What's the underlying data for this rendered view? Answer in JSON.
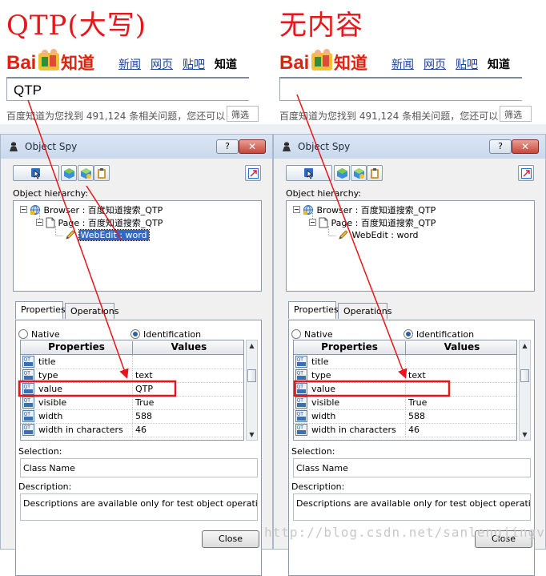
{
  "panels": [
    {
      "annotation": "QTP(大写)",
      "baidu": {
        "logo_text": "Bai知道",
        "nav_links": [
          "新闻",
          "网页",
          "贴吧"
        ],
        "nav_current": "知道",
        "search_value": "QTP",
        "found_text": "百度知道为您找到 491,124 条相关问题，您还可以",
        "filter_label": "筛选"
      },
      "window": {
        "title": "Object Spy",
        "help_label": "?",
        "close_label": "✕",
        "hierarchy_label": "Object hierarchy:",
        "tree": [
          "Browser : 百度知道搜索_QTP",
          "Page : 百度知道搜索_QTP",
          "WebEdit : word"
        ],
        "tabs": [
          "Properties",
          "Operations"
        ],
        "radios": [
          "Native",
          "Identification"
        ],
        "grid_headers": [
          "Properties",
          "Values"
        ],
        "rows": [
          {
            "name": "title",
            "value": ""
          },
          {
            "name": "type",
            "value": "text"
          },
          {
            "name": "value",
            "value": "QTP"
          },
          {
            "name": "visible",
            "value": "True"
          },
          {
            "name": "width",
            "value": "588"
          },
          {
            "name": "width in characters",
            "value": "46"
          }
        ],
        "selection_label": "Selection:",
        "selection_value": "Class Name",
        "description_label": "Description:",
        "description_value": "Descriptions are available only for test object operations.",
        "close_button": "Close"
      }
    },
    {
      "annotation": "无内容",
      "baidu": {
        "logo_text": "Bai知道",
        "nav_links": [
          "新闻",
          "网页",
          "贴吧"
        ],
        "nav_current": "知道",
        "search_value": "",
        "found_text": "百度知道为您找到 491,124 条相关问题，您还可以",
        "filter_label": "筛选"
      },
      "window": {
        "title": "Object Spy",
        "help_label": "?",
        "close_label": "✕",
        "hierarchy_label": "Object hierarchy:",
        "tree": [
          "Browser : 百度知道搜索_QTP",
          "Page : 百度知道搜索_QTP",
          "WebEdit : word"
        ],
        "tabs": [
          "Properties",
          "Operations"
        ],
        "radios": [
          "Native",
          "Identification"
        ],
        "grid_headers": [
          "Properties",
          "Values"
        ],
        "rows": [
          {
            "name": "title",
            "value": ""
          },
          {
            "name": "type",
            "value": "text"
          },
          {
            "name": "value",
            "value": ""
          },
          {
            "name": "visible",
            "value": "True"
          },
          {
            "name": "width",
            "value": "588"
          },
          {
            "name": "width in characters",
            "value": "46"
          }
        ],
        "selection_label": "Selection:",
        "selection_value": "Class Name",
        "description_label": "Description:",
        "description_value": "Descriptions are available only for test object operations.",
        "close_button": "Close"
      }
    }
  ],
  "watermark": "http://blog.csdn.net/sanlengjingvv",
  "colors": {
    "annotation_red": "#e8161a",
    "link_blue": "#1a3e99",
    "selection_blue": "#3169c6"
  }
}
